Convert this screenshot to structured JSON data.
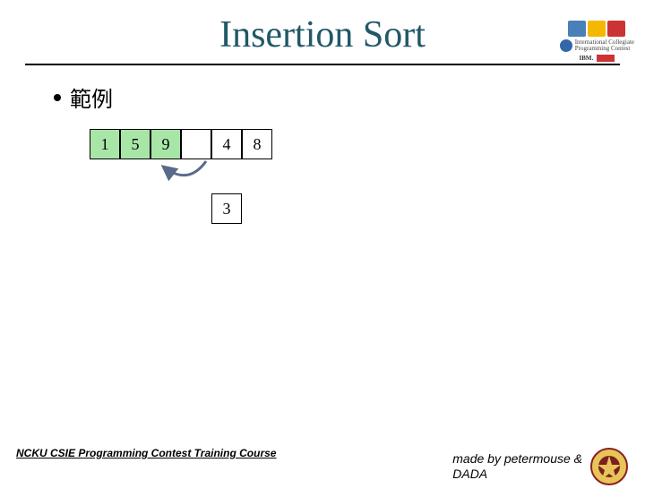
{
  "title": "Insertion Sort",
  "bullet_label": "範例",
  "array": {
    "sorted": [
      "1",
      "5",
      "9"
    ],
    "right": [
      "4",
      "8"
    ],
    "below": "3"
  },
  "footer": {
    "left": "NCKU CSIE Programming Contest Training Course",
    "credits_line1": "made by petermouse &",
    "credits_line2": "DADA"
  },
  "topright": {
    "acm_line1": "International Collegiate",
    "acm_line2": "Programming Contest",
    "ibm": "IBM."
  }
}
